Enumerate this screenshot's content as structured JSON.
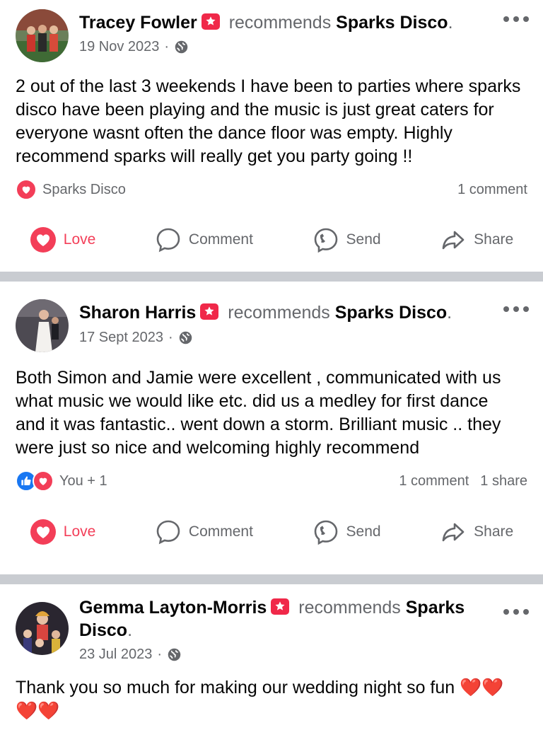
{
  "posts": [
    {
      "author": "Tracey Fowler",
      "verb": "recommends",
      "page": "Sparks Disco",
      "date": "19 Nov 2023",
      "text": "2 out of the last 3 weekends I have been to parties where sparks disco have been playing and the music is just great caters for everyone wasnt often the dance floor was empty. Highly recommend sparks will really get you party going !!",
      "reaction_label": "Sparks Disco",
      "comments": "1 comment",
      "shares": ""
    },
    {
      "author": "Sharon Harris",
      "verb": "recommends",
      "page": "Sparks Disco",
      "date": "17 Sept 2023",
      "text": "Both Simon and Jamie were excellent , communicated with us what music we would like etc. did us a medley for first dance and it was fantastic.. went down a storm. Brilliant music .. they were just so nice and welcoming highly recommend",
      "reaction_label": "You + 1",
      "comments": "1 comment",
      "shares": "1 share"
    },
    {
      "author": "Gemma Layton-Morris",
      "verb": "recommends",
      "page": "Sparks Disco",
      "date": "23 Jul 2023",
      "text": "Thank you so much for making our wedding night so fun ❤️❤️❤️❤️"
    }
  ],
  "actions": {
    "love": "Love",
    "comment": "Comment",
    "send": "Send",
    "share": "Share"
  },
  "colors": {
    "love": "#f33e58",
    "like": "#1877f2",
    "badge": "#f02849",
    "secondary_text": "#65676b",
    "divider": "#c9ccd1"
  },
  "icons": [
    "recommend-badge-icon",
    "globe-icon",
    "more-icon",
    "love-icon",
    "comment-icon",
    "messenger-icon",
    "share-icon",
    "like-icon"
  ]
}
